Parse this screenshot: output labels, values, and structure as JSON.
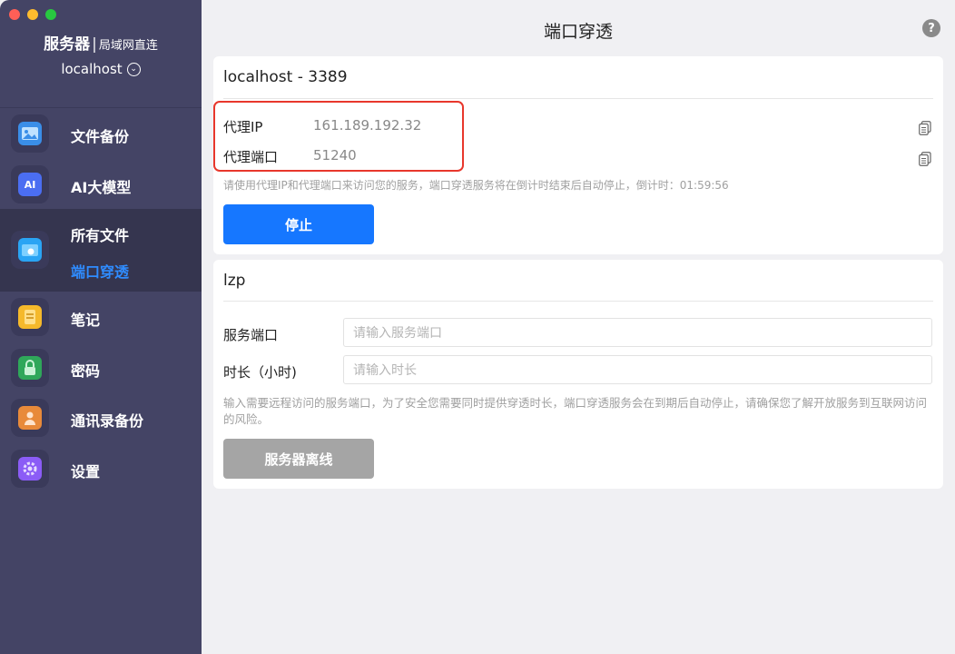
{
  "window": {
    "title": "端口穿透"
  },
  "sidebar": {
    "brand": "服务器",
    "brand_sep": "|",
    "brand_sub": "局域网直连",
    "host": "localhost",
    "items": [
      {
        "label": "文件备份",
        "icon": "image-backup-icon",
        "color": "#3a8ee8"
      },
      {
        "label": "AI大模型",
        "icon": "ai-model-icon",
        "color": "#4b6ef2"
      },
      {
        "label": "所有文件",
        "sub_label": "端口穿透",
        "icon": "apple-folder-icon",
        "color": "#2aa4f4"
      },
      {
        "label": "笔记",
        "icon": "note-icon",
        "color": "#f5b92b"
      },
      {
        "label": "密码",
        "icon": "lock-icon",
        "color": "#2fa75a"
      },
      {
        "label": "通讯录备份",
        "icon": "contacts-icon",
        "color": "#e88a3a"
      },
      {
        "label": "设置",
        "icon": "gear-icon",
        "color": "#8b5cf6"
      }
    ],
    "active_sub_color": "#2f8cff"
  },
  "proxy_card": {
    "title": "localhost - 3389",
    "ip_label": "代理IP",
    "ip_value": "161.189.192.32",
    "port_label": "代理端口",
    "port_value": "51240",
    "hint": "请使用代理IP和代理端口来访问您的服务，端口穿透服务将在倒计时结束后自动停止，倒计时：01:59:56",
    "stop_button": "停止"
  },
  "config_card": {
    "title": "lzp",
    "port_label": "服务端口",
    "port_placeholder": "请输入服务端口",
    "duration_label": "时长（小时)",
    "duration_placeholder": "请输入时长",
    "hint": "输入需要远程访问的服务端口，为了安全您需要同时提供穿透时长，端口穿透服务会在到期后自动停止，请确保您了解开放服务到互联网访问的风险。",
    "offline_button": "服务器离线"
  },
  "colors": {
    "accent": "#1677ff",
    "highlight": "#e8372c",
    "sidebar": "#444465"
  }
}
